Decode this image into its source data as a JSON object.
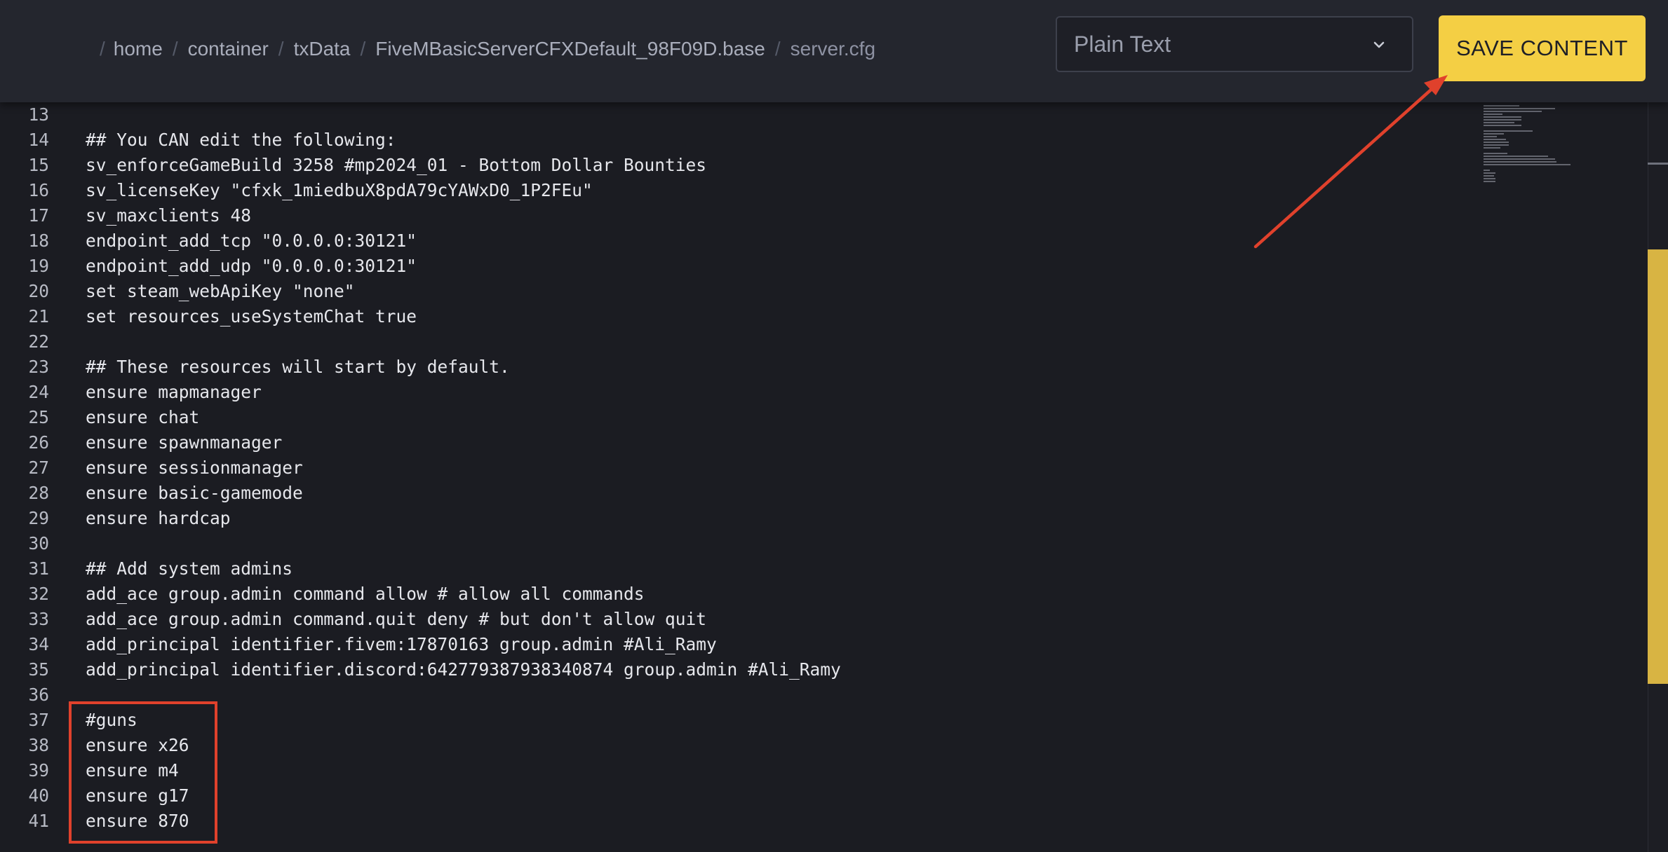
{
  "breadcrumb": {
    "items": [
      "home",
      "container",
      "txData",
      "FiveMBasicServerCFXDefault_98F09D.base",
      "server.cfg"
    ]
  },
  "language_select": {
    "value": "Plain Text"
  },
  "save_button": {
    "label": "SAVE CONTENT"
  },
  "editor": {
    "lines": [
      {
        "num": "13",
        "text": ""
      },
      {
        "num": "14",
        "text": "## You CAN edit the following:"
      },
      {
        "num": "15",
        "text": "sv_enforceGameBuild 3258 #mp2024_01 - Bottom Dollar Bounties"
      },
      {
        "num": "16",
        "text": "sv_licenseKey \"cfxk_1miedbuX8pdA79cYAWxD0_1P2FEu\""
      },
      {
        "num": "17",
        "text": "sv_maxclients 48"
      },
      {
        "num": "18",
        "text": "endpoint_add_tcp \"0.0.0.0:30121\""
      },
      {
        "num": "19",
        "text": "endpoint_add_udp \"0.0.0.0:30121\""
      },
      {
        "num": "20",
        "text": "set steam_webApiKey \"none\""
      },
      {
        "num": "21",
        "text": "set resources_useSystemChat true"
      },
      {
        "num": "22",
        "text": ""
      },
      {
        "num": "23",
        "text": "## These resources will start by default."
      },
      {
        "num": "24",
        "text": "ensure mapmanager"
      },
      {
        "num": "25",
        "text": "ensure chat"
      },
      {
        "num": "26",
        "text": "ensure spawnmanager"
      },
      {
        "num": "27",
        "text": "ensure sessionmanager"
      },
      {
        "num": "28",
        "text": "ensure basic-gamemode"
      },
      {
        "num": "29",
        "text": "ensure hardcap"
      },
      {
        "num": "30",
        "text": ""
      },
      {
        "num": "31",
        "text": "## Add system admins"
      },
      {
        "num": "32",
        "text": "add_ace group.admin command allow # allow all commands"
      },
      {
        "num": "33",
        "text": "add_ace group.admin command.quit deny # but don't allow quit"
      },
      {
        "num": "34",
        "text": "add_principal identifier.fivem:17870163 group.admin #Ali_Ramy"
      },
      {
        "num": "35",
        "text": "add_principal identifier.discord:642779387938340874 group.admin #Ali_Ramy"
      },
      {
        "num": "36",
        "text": ""
      },
      {
        "num": "37",
        "text": "#guns"
      },
      {
        "num": "38",
        "text": "ensure x26"
      },
      {
        "num": "39",
        "text": "ensure m4"
      },
      {
        "num": "40",
        "text": "ensure g17"
      },
      {
        "num": "41",
        "text": "ensure 870"
      }
    ]
  },
  "colors": {
    "accent": "#f4cf44",
    "annotation": "#e0412c",
    "background": "#1b1c22",
    "header": "#24262e"
  },
  "icons": {
    "select": "chevron-down-icon"
  }
}
